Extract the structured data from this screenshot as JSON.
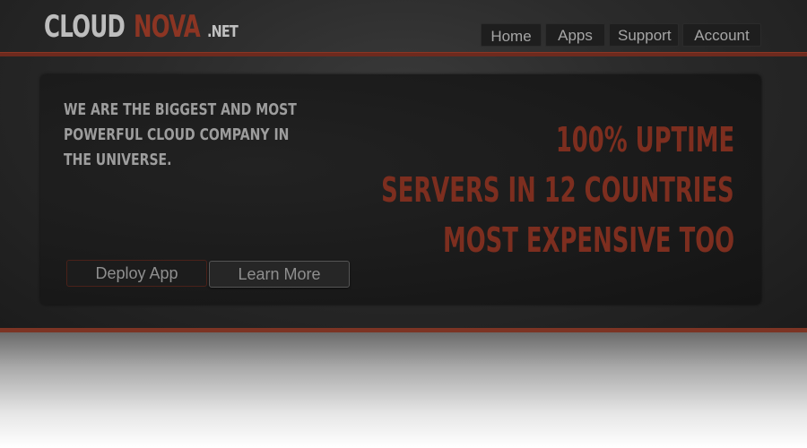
{
  "logo": {
    "cloud": "CLOUD",
    "nova": "NOVA",
    "net": ".NET"
  },
  "nav": {
    "items": [
      {
        "label": "Home"
      },
      {
        "label": "Apps"
      },
      {
        "label": "Support"
      },
      {
        "label": "Account"
      }
    ]
  },
  "hero": {
    "tagline_lines": [
      "WE ARE THE BIGGEST AND MOST",
      "POWERFUL CLOUD COMPANY IN",
      "THE UNIVERSE."
    ],
    "features": [
      "100% UPTIME",
      "SERVERS IN 12 COUNTRIES",
      "MOST EXPENSIVE TOO"
    ],
    "buttons": {
      "deploy": "Deploy App",
      "learn": "Learn More"
    }
  },
  "colors": {
    "accent_red": "#7d2e1f",
    "logo_gray": "#bdbdbd",
    "header_bg": "#2a2a2a"
  }
}
